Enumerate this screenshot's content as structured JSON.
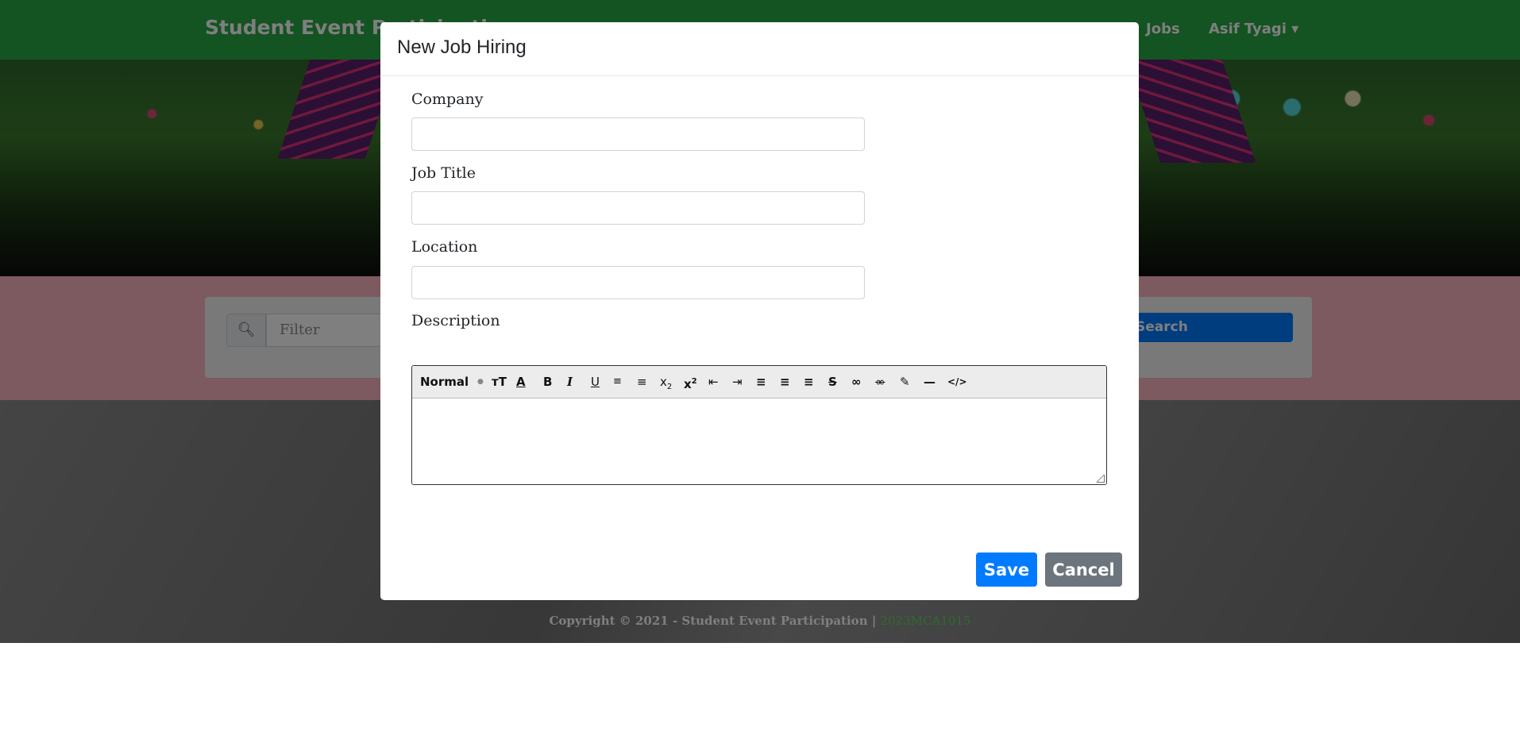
{
  "navbar": {
    "brand": "Student Event Participation",
    "links": [
      "Jobs",
      "Asif Tyagi ▾"
    ]
  },
  "filter": {
    "placeholder": "Filter",
    "search_label": "Search"
  },
  "footer": {
    "copyright": "Copyright © 2021 - Student Event Participation | ",
    "accent": "2023MCA1015"
  },
  "modal": {
    "title": "New Job Hiring",
    "fields": {
      "company_label": "Company",
      "job_title_label": "Job Title",
      "location_label": "Location",
      "description_label": "Description"
    },
    "editor": {
      "format_select": "Normal",
      "tools": [
        "font-size-icon",
        "font-color-icon",
        "bold-icon",
        "italic-icon",
        "underline-icon",
        "ordered-list-icon",
        "unordered-list-icon",
        "subscript-icon",
        "superscript-icon",
        "outdent-icon",
        "indent-icon",
        "align-left-icon",
        "align-center-icon",
        "align-right-icon",
        "strikethrough-icon",
        "link-icon",
        "unlink-icon",
        "highlight-icon",
        "horizontal-rule-icon",
        "code-icon"
      ]
    },
    "buttons": {
      "save": "Save",
      "cancel": "Cancel"
    }
  },
  "colors": {
    "navbar": "#28a745",
    "primary": "#007bff",
    "secondary": "#6c757d",
    "pink_section": "#f8b4c0"
  }
}
